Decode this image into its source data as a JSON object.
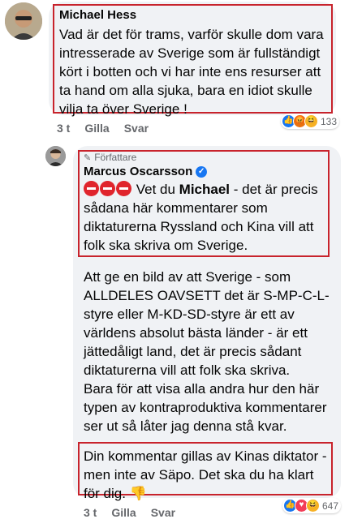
{
  "comment1": {
    "author": "Michael Hess",
    "text": "Vad är det för trams, varför skulle dom vara intresserade av Sverige som är fullständigt kört i botten och vi har inte ens resurser att ta hand om alla sjuka, bara en idiot skulle vilja ta över Sverige !",
    "time": "3 t",
    "like_label": "Gilla",
    "reply_label": "Svar",
    "reaction_count": "133",
    "reactions": [
      "like-icon",
      "angry-icon",
      "haha-icon"
    ]
  },
  "reply": {
    "badge": "Författare",
    "author": "Marcus Oscarsson",
    "para1_prefix": " Vet du ",
    "para1_name": "Michael",
    "para1_rest": " - det är precis sådana här kommentarer som diktaturerna Ryssland och Kina vill att folk ska skriva om Sverige.",
    "para2": "Att ge en bild av att Sverige - som ALLDELES OAVSETT det är S-MP-C-L-styre eller M-KD-SD-styre är ett av världens absolut bästa länder - är ett jättedåligt land, det är precis sådant diktaturerna vill att folk ska skriva.\nBara för att visa alla andra hur den här typen av kontraproduktiva kommentarer ser ut så låter jag denna stå kvar.",
    "para3": "Din kommentar gillas av Kinas diktator - men inte av Säpo. Det ska du ha klart för dig.",
    "thumb_emoji": "👎",
    "time": "3 t",
    "like_label": "Gilla",
    "reply_label": "Svar",
    "reaction_count": "647",
    "reactions": [
      "like-icon",
      "love-icon",
      "haha-icon"
    ]
  },
  "colors": {
    "highlight_border": "#c8232c",
    "bubble": "#f0f2f5",
    "like": "#1877f2",
    "secondary_text": "#65676b"
  }
}
